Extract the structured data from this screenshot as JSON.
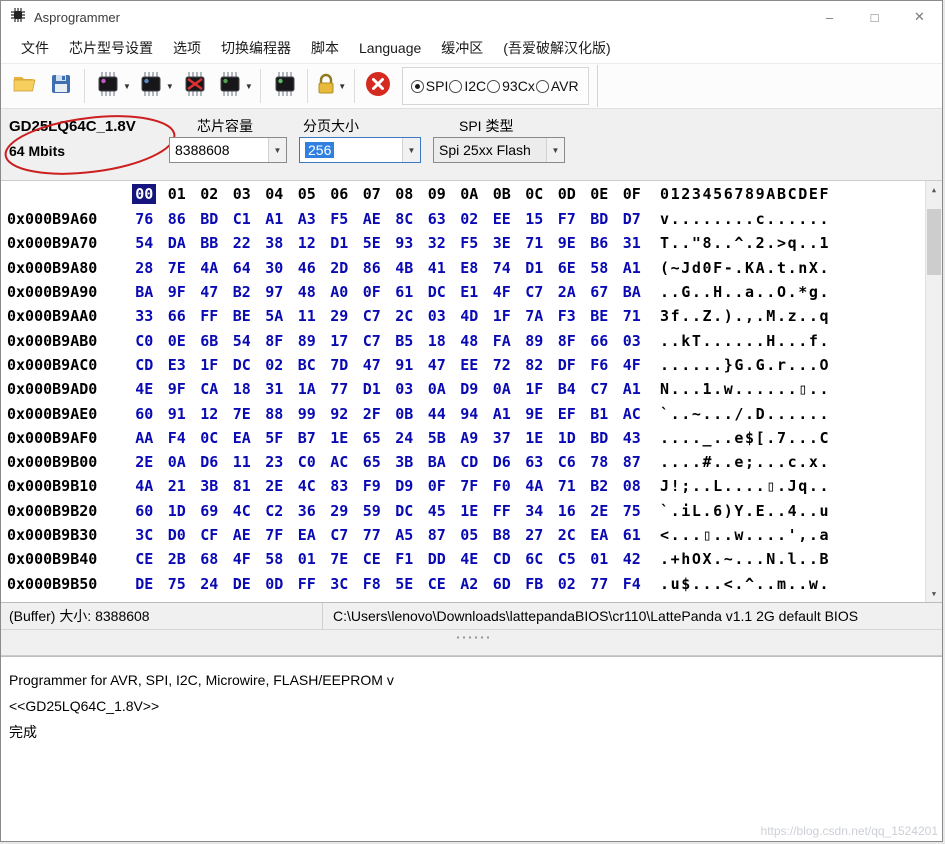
{
  "window": {
    "title": "Asprogrammer",
    "controls": {
      "minimize": "–",
      "maximize": "□",
      "close": "✕"
    }
  },
  "menu": {
    "items": [
      "文件",
      "芯片型号设置",
      "选项",
      "切换编程器",
      "脚本",
      "Language",
      "缓冲区",
      "(吾爱破解汉化版)"
    ]
  },
  "toolbar": {
    "radio_options": [
      {
        "label": "SPI",
        "selected": true
      },
      {
        "label": "I2C",
        "selected": false
      },
      {
        "label": "93Cx",
        "selected": false
      },
      {
        "label": "AVR",
        "selected": false
      }
    ],
    "icons": [
      "folder-open-icon",
      "save-icon",
      "chip-read-icon",
      "chip-write-icon",
      "chip-erase-icon",
      "chip-verify-icon",
      "chip-detect-icon",
      "lock-icon",
      "stop-icon"
    ]
  },
  "chip_panel": {
    "chip_name": "GD25LQ64C_1.8V",
    "chip_size": "64 Mbits",
    "capacity_label": "芯片容量",
    "capacity_value": "8388608",
    "page_label": "分页大小",
    "page_value": "256",
    "spi_type_label": "SPI 类型",
    "spi_type_value": "Spi 25xx Flash"
  },
  "hex": {
    "col_headers": [
      "00",
      "01",
      "02",
      "03",
      "04",
      "05",
      "06",
      "07",
      "08",
      "09",
      "0A",
      "0B",
      "0C",
      "0D",
      "0E",
      "0F"
    ],
    "ascii_header": "0123456789ABCDEF",
    "selected_col_index": 0,
    "rows": [
      {
        "addr": "0x000B9A60",
        "bytes": [
          "76",
          "86",
          "BD",
          "C1",
          "A1",
          "A3",
          "F5",
          "AE",
          "8C",
          "63",
          "02",
          "EE",
          "15",
          "F7",
          "BD",
          "D7"
        ],
        "ascii": "v........c......"
      },
      {
        "addr": "0x000B9A70",
        "bytes": [
          "54",
          "DA",
          "BB",
          "22",
          "38",
          "12",
          "D1",
          "5E",
          "93",
          "32",
          "F5",
          "3E",
          "71",
          "9E",
          "B6",
          "31"
        ],
        "ascii": "T..\"8..^.2.>q..1"
      },
      {
        "addr": "0x000B9A80",
        "bytes": [
          "28",
          "7E",
          "4A",
          "64",
          "30",
          "46",
          "2D",
          "86",
          "4B",
          "41",
          "E8",
          "74",
          "D1",
          "6E",
          "58",
          "A1"
        ],
        "ascii": "(~Jd0F-.KA.t.nX."
      },
      {
        "addr": "0x000B9A90",
        "bytes": [
          "BA",
          "9F",
          "47",
          "B2",
          "97",
          "48",
          "A0",
          "0F",
          "61",
          "DC",
          "E1",
          "4F",
          "C7",
          "2A",
          "67",
          "BA"
        ],
        "ascii": "..G..H..a..O.*g."
      },
      {
        "addr": "0x000B9AA0",
        "bytes": [
          "33",
          "66",
          "FF",
          "BE",
          "5A",
          "11",
          "29",
          "C7",
          "2C",
          "03",
          "4D",
          "1F",
          "7A",
          "F3",
          "BE",
          "71"
        ],
        "ascii": "3f..Z.).,.M.z..q"
      },
      {
        "addr": "0x000B9AB0",
        "bytes": [
          "C0",
          "0E",
          "6B",
          "54",
          "8F",
          "89",
          "17",
          "C7",
          "B5",
          "18",
          "48",
          "FA",
          "89",
          "8F",
          "66",
          "03"
        ],
        "ascii": "..kT......H...f."
      },
      {
        "addr": "0x000B9AC0",
        "bytes": [
          "CD",
          "E3",
          "1F",
          "DC",
          "02",
          "BC",
          "7D",
          "47",
          "91",
          "47",
          "EE",
          "72",
          "82",
          "DF",
          "F6",
          "4F"
        ],
        "ascii": "......}G.G.r...O"
      },
      {
        "addr": "0x000B9AD0",
        "bytes": [
          "4E",
          "9F",
          "CA",
          "18",
          "31",
          "1A",
          "77",
          "D1",
          "03",
          "0A",
          "D9",
          "0A",
          "1F",
          "B4",
          "C7",
          "A1"
        ],
        "ascii": "N...1.w......▯.."
      },
      {
        "addr": "0x000B9AE0",
        "bytes": [
          "60",
          "91",
          "12",
          "7E",
          "88",
          "99",
          "92",
          "2F",
          "0B",
          "44",
          "94",
          "A1",
          "9E",
          "EF",
          "B1",
          "AC"
        ],
        "ascii": "`..~.../.D......"
      },
      {
        "addr": "0x000B9AF0",
        "bytes": [
          "AA",
          "F4",
          "0C",
          "EA",
          "5F",
          "B7",
          "1E",
          "65",
          "24",
          "5B",
          "A9",
          "37",
          "1E",
          "1D",
          "BD",
          "43"
        ],
        "ascii": "...._..e$[.7...C"
      },
      {
        "addr": "0x000B9B00",
        "bytes": [
          "2E",
          "0A",
          "D6",
          "11",
          "23",
          "C0",
          "AC",
          "65",
          "3B",
          "BA",
          "CD",
          "D6",
          "63",
          "C6",
          "78",
          "87"
        ],
        "ascii": "....#..e;...c.x."
      },
      {
        "addr": "0x000B9B10",
        "bytes": [
          "4A",
          "21",
          "3B",
          "81",
          "2E",
          "4C",
          "83",
          "F9",
          "D9",
          "0F",
          "7F",
          "F0",
          "4A",
          "71",
          "B2",
          "08"
        ],
        "ascii": "J!;..L....▯.Jq.."
      },
      {
        "addr": "0x000B9B20",
        "bytes": [
          "60",
          "1D",
          "69",
          "4C",
          "C2",
          "36",
          "29",
          "59",
          "DC",
          "45",
          "1E",
          "FF",
          "34",
          "16",
          "2E",
          "75"
        ],
        "ascii": "`.iL.6)Y.E..4..u"
      },
      {
        "addr": "0x000B9B30",
        "bytes": [
          "3C",
          "D0",
          "CF",
          "AE",
          "7F",
          "EA",
          "C7",
          "77",
          "A5",
          "87",
          "05",
          "B8",
          "27",
          "2C",
          "EA",
          "61"
        ],
        "ascii": "<...▯..w....',.a"
      },
      {
        "addr": "0x000B9B40",
        "bytes": [
          "CE",
          "2B",
          "68",
          "4F",
          "58",
          "01",
          "7E",
          "CE",
          "F1",
          "DD",
          "4E",
          "CD",
          "6C",
          "C5",
          "01",
          "42"
        ],
        "ascii": ".+hOX.~...N.l..B"
      },
      {
        "addr": "0x000B9B50",
        "bytes": [
          "DE",
          "75",
          "24",
          "DE",
          "0D",
          "FF",
          "3C",
          "F8",
          "5E",
          "CE",
          "A2",
          "6D",
          "FB",
          "02",
          "77",
          "F4"
        ],
        "ascii": ".u$...<.^..m..w."
      }
    ]
  },
  "status_bar": {
    "buffer_label": "(Buffer) 大小:  8388608",
    "file_path": "C:\\Users\\lenovo\\Downloads\\lattepandaBIOS\\cr110\\LattePanda v1.1 2G default BIOS"
  },
  "log": {
    "lines": [
      "Programmer for AVR, SPI, I2C, Microwire, FLASH/EEPROM v",
      "<<GD25LQ64C_1.8V>>",
      "完成"
    ]
  },
  "watermark": "https://blog.csdn.net/qq_1524201",
  "colors": {
    "hex_byte": "#0a0ab4",
    "selection": "#2f80e0",
    "annotation": "#cc1f1f",
    "header_selected_bg": "#15157d"
  }
}
